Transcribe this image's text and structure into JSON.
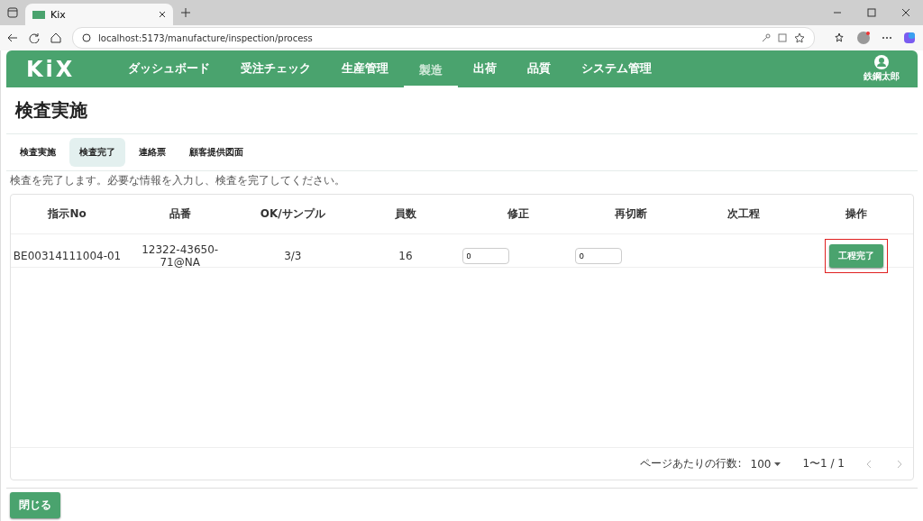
{
  "browser": {
    "tab_title": "Kix",
    "url": "localhost:5173/manufacture/inspection/process"
  },
  "header": {
    "logo": "KiX",
    "nav": [
      {
        "label": "ダッシュボード",
        "selected": false
      },
      {
        "label": "受注チェック",
        "selected": false
      },
      {
        "label": "生産管理",
        "selected": false
      },
      {
        "label": "製造",
        "selected": true
      },
      {
        "label": "出荷",
        "selected": false
      },
      {
        "label": "品質",
        "selected": false
      },
      {
        "label": "システム管理",
        "selected": false
      }
    ],
    "user": "鉄鋼太郎"
  },
  "page_title": "検査実施",
  "tabs": [
    {
      "label": "検査実施",
      "selected": false
    },
    {
      "label": "検査完了",
      "selected": true
    },
    {
      "label": "連絡票",
      "selected": false
    },
    {
      "label": "顧客提供図面",
      "selected": false
    }
  ],
  "description": "検査を完了します。必要な情報を入力し、検査を完了してください。",
  "table": {
    "columns": [
      "指示No",
      "品番",
      "OK/サンプル",
      "員数",
      "修正",
      "再切断",
      "次工程",
      "操作"
    ],
    "rows": [
      {
        "order_no": "BE00314111004-01",
        "part_no": "12322-43650-71@NA",
        "ok_sample": "3/3",
        "quantity": "16",
        "fix": "0",
        "recut": "0",
        "action": "工程完了",
        "highlighted": true
      }
    ]
  },
  "pagination": {
    "rows_per_page_label": "ページあたりの行数:",
    "rows_per_page": "100",
    "range": "1〜1 / 1"
  },
  "close_button": "閉じる"
}
